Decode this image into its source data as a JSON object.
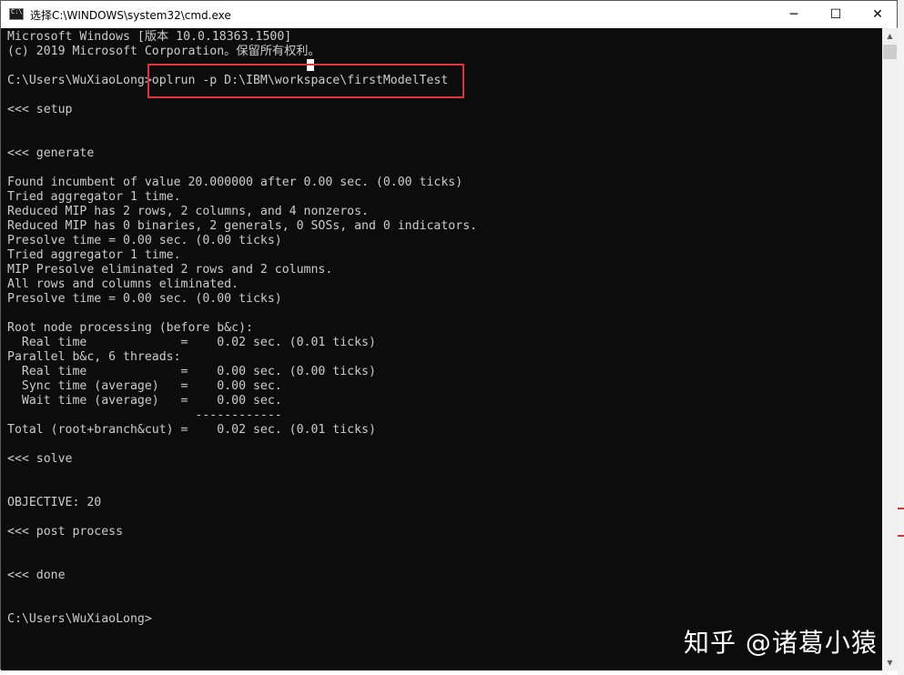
{
  "window": {
    "title": "选择C:\\WINDOWS\\system32\\cmd.exe",
    "minimize_glyph": "─",
    "maximize_glyph": "☐",
    "close_glyph": "✕"
  },
  "icons": {
    "app": "cmd-icon",
    "minimize": "minimize-icon",
    "maximize": "maximize-icon",
    "close": "close-icon"
  },
  "console": {
    "lines": [
      "Microsoft Windows [版本 10.0.18363.1500]",
      "(c) 2019 Microsoft Corporation。保留所有权利。",
      "",
      "C:\\Users\\WuXiaoLong>oplrun -p D:\\IBM\\workspace\\firstModelTest",
      "",
      "<<< setup",
      "",
      "",
      "<<< generate",
      "",
      "Found incumbent of value 20.000000 after 0.00 sec. (0.00 ticks)",
      "Tried aggregator 1 time.",
      "Reduced MIP has 2 rows, 2 columns, and 4 nonzeros.",
      "Reduced MIP has 0 binaries, 2 generals, 0 SOSs, and 0 indicators.",
      "Presolve time = 0.00 sec. (0.00 ticks)",
      "Tried aggregator 1 time.",
      "MIP Presolve eliminated 2 rows and 2 columns.",
      "All rows and columns eliminated.",
      "Presolve time = 0.00 sec. (0.00 ticks)",
      "",
      "Root node processing (before b&c):",
      "  Real time             =    0.02 sec. (0.01 ticks)",
      "Parallel b&c, 6 threads:",
      "  Real time             =    0.00 sec. (0.00 ticks)",
      "  Sync time (average)   =    0.00 sec.",
      "  Wait time (average)   =    0.00 sec.",
      "                          ------------",
      "Total (root+branch&cut) =    0.02 sec. (0.01 ticks)",
      "",
      "<<< solve",
      "",
      "",
      "OBJECTIVE: 20",
      "",
      "<<< post process",
      "",
      "",
      "<<< done",
      "",
      "",
      "C:\\Users\\WuXiaoLong>"
    ]
  },
  "watermark": "知乎 @诸葛小猿",
  "colors": {
    "console_bg": "#0c0c0c",
    "console_text": "#cccccc",
    "highlight": "#e0333b"
  }
}
